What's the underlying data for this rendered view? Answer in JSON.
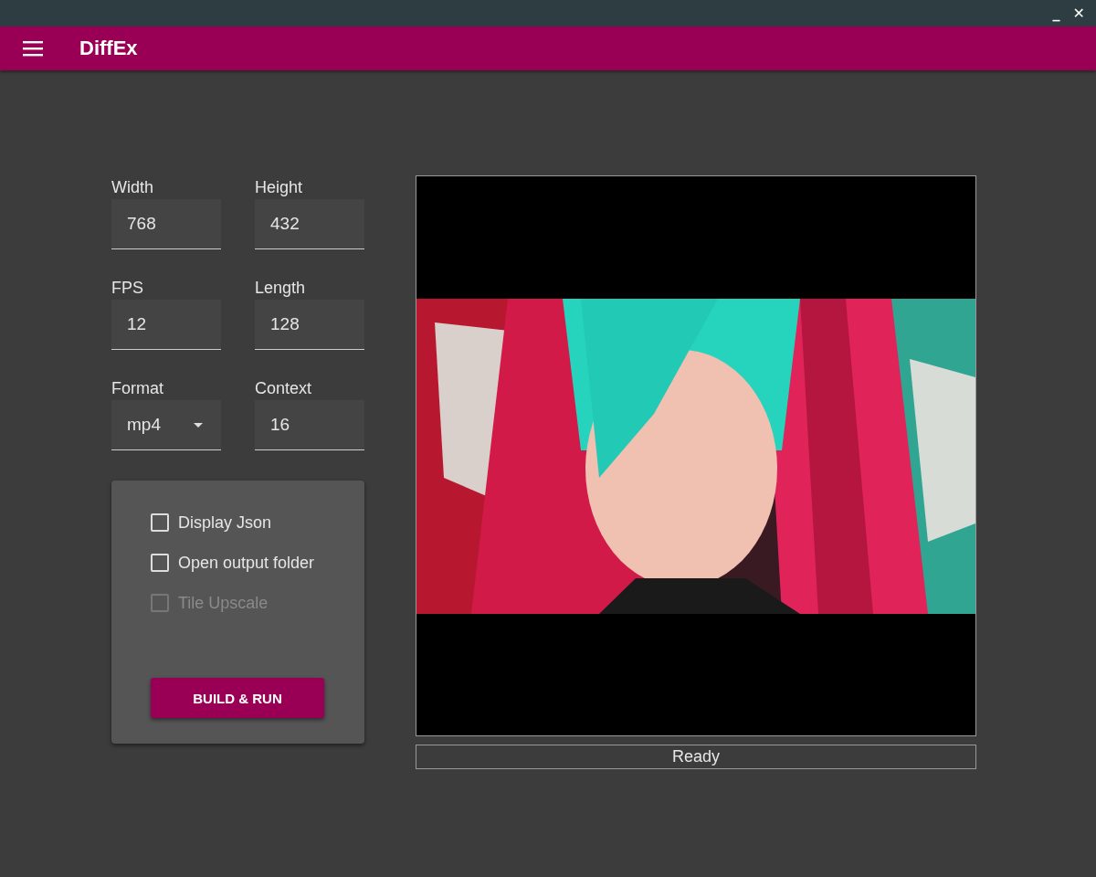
{
  "window": {
    "controls": [
      "_",
      "✕"
    ]
  },
  "app_bar": {
    "title": "DiffEx"
  },
  "fields": [
    {
      "label": "Width",
      "value": "768",
      "kind": "text"
    },
    {
      "label": "Height",
      "value": "432",
      "kind": "text"
    },
    {
      "label": "FPS",
      "value": "12",
      "kind": "text"
    },
    {
      "label": "Length",
      "value": "128",
      "kind": "text"
    },
    {
      "label": "Format",
      "value": "mp4",
      "kind": "select"
    },
    {
      "label": "Context",
      "value": "16",
      "kind": "text"
    }
  ],
  "options": [
    {
      "label": "Display Json",
      "checked": false,
      "disabled": false
    },
    {
      "label": "Open output folder",
      "checked": false,
      "disabled": false
    },
    {
      "label": "Tile Upscale",
      "checked": false,
      "disabled": true
    }
  ],
  "run_button": "BUILD & RUN",
  "status": "Ready"
}
